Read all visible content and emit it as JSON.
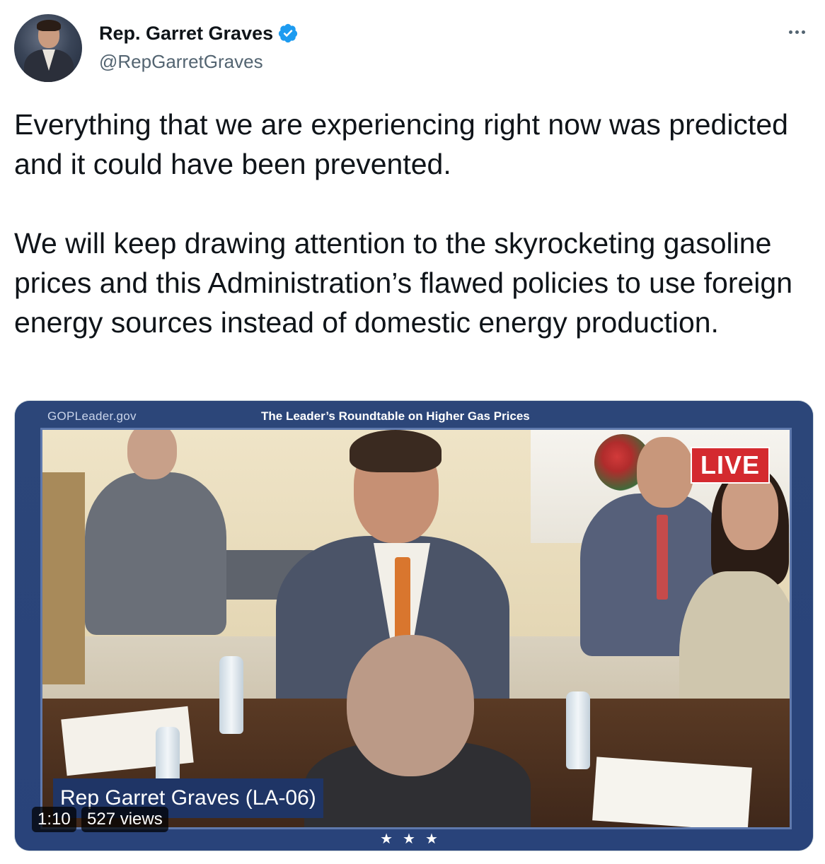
{
  "author": {
    "display_name": "Rep. Garret Graves",
    "handle": "@RepGarretGraves",
    "verified": true,
    "badge_color": "#1d9bf0"
  },
  "tweet": {
    "text": "Everything that we are experiencing right now was predicted and it could have been prevented.\n\nWe will keep drawing attention to the skyrocketing gasoline prices and this Administration’s flawed policies to use foreign energy sources instead of domestic energy production."
  },
  "media": {
    "site_label": "GOPLeader.gov",
    "show_title": "The Leader’s Roundtable on Higher Gas Prices",
    "live_label": "LIVE",
    "lower_third": "Rep Garret Graves (LA-06)",
    "stars": "★★★",
    "duration": "1:10",
    "views": "527 views",
    "frame_color": "#2c4679",
    "live_color": "#d42a2f"
  },
  "icons": {
    "more": "more-horizontal-icon",
    "verified": "verified-badge-icon"
  }
}
